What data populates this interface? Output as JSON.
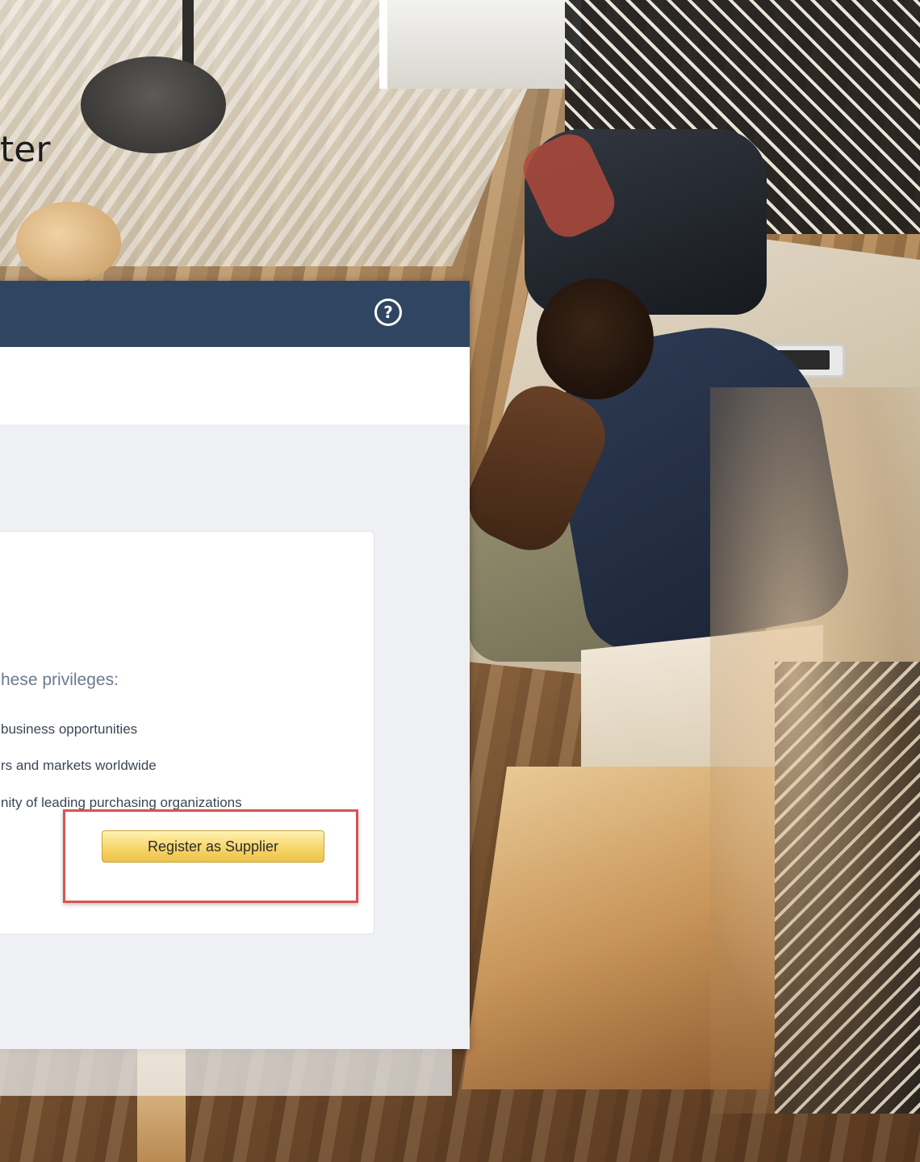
{
  "background": {
    "partial_heading": "ter"
  },
  "window": {
    "titlebar_color": "#2f4561",
    "help_icon": "help-circle-icon",
    "help_icon_glyph": "?",
    "card": {
      "privileges_heading": "hese privileges:",
      "benefits": [
        "business opportunities",
        "rs and markets worldwide",
        "nity of leading purchasing organizations"
      ],
      "register_button_label": "Register as Supplier",
      "button_color": "#f6d56a",
      "highlight_color": "#d9534f"
    }
  }
}
